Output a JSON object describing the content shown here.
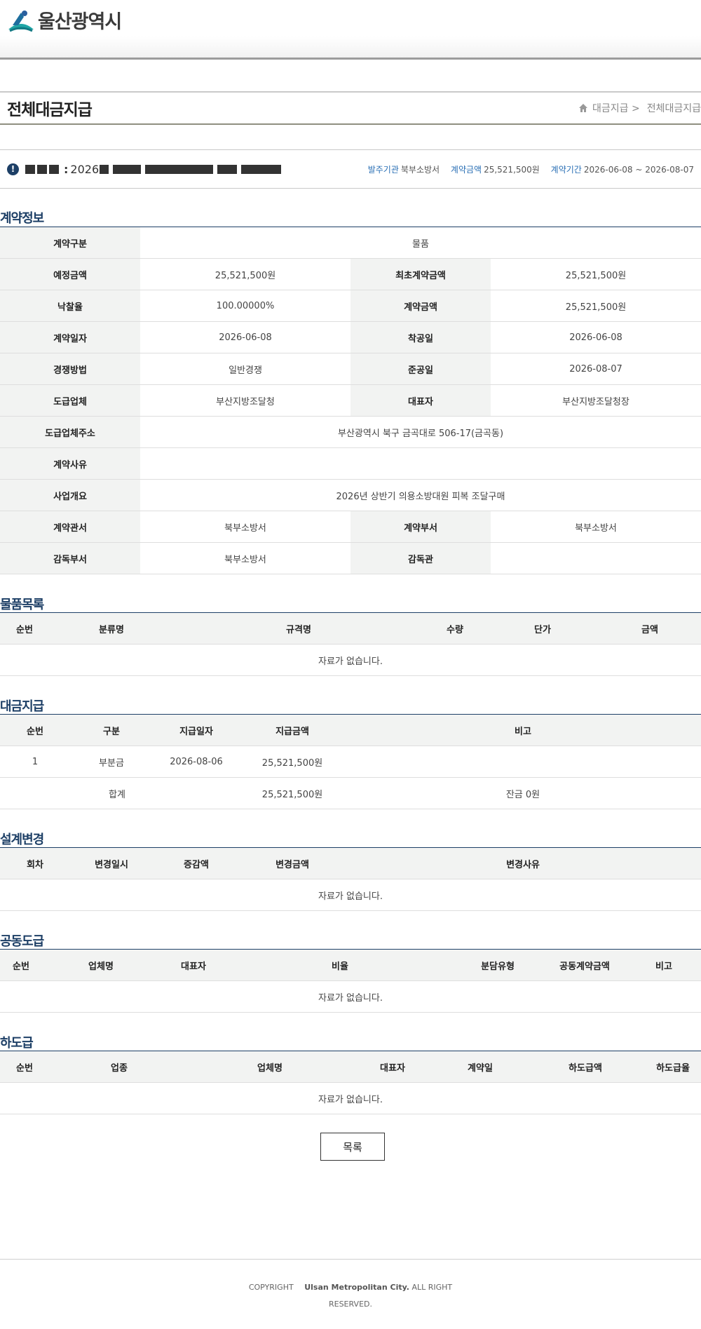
{
  "header": {
    "logo_text": "울산광역시"
  },
  "page": {
    "title": "전체대금지급",
    "breadcrumb": [
      "대금지급 >",
      "전체대금지급"
    ]
  },
  "summary": {
    "title_prefix": ":",
    "title_year": "2026",
    "agency_label": "발주기관",
    "agency_value": "북부소방서",
    "amount_label": "계약금액",
    "amount_value": "25,521,500원",
    "period_label": "계약기간",
    "period_value": "2026-06-08 ~ 2026-08-07"
  },
  "contract_info": {
    "section_title": "계약정보",
    "rows": [
      {
        "label1": "계약구분",
        "value1": "물품",
        "full": true
      },
      {
        "label1": "예정금액",
        "value1": "25,521,500원",
        "label2": "최초계약금액",
        "value2": "25,521,500원"
      },
      {
        "label1": "낙찰율",
        "value1": "100.00000%",
        "label2": "계약금액",
        "value2": "25,521,500원"
      },
      {
        "label1": "계약일자",
        "value1": "2026-06-08",
        "label2": "착공일",
        "value2": "2026-06-08"
      },
      {
        "label1": "경쟁방법",
        "value1": "일반경쟁",
        "label2": "준공일",
        "value2": "2026-08-07"
      },
      {
        "label1": "도급업체",
        "value1": "부산지방조달청",
        "label2": "대표자",
        "value2": "부산지방조달청장"
      },
      {
        "label1": "도급업체주소",
        "value1": "부산광역시 북구 금곡대로 506-17(금곡동)",
        "full": true
      },
      {
        "label1": "계약사유",
        "value1": "",
        "full": true
      },
      {
        "label1": "사업개요",
        "value1": "2026년 상반기 의용소방대원 피복 조달구매",
        "full": true
      },
      {
        "label1": "계약관서",
        "value1": "북부소방서",
        "label2": "계약부서",
        "value2": "북부소방서"
      },
      {
        "label1": "감독부서",
        "value1": "북부소방서",
        "label2": "감독관",
        "value2": ""
      }
    ]
  },
  "goods": {
    "section_title": "물품목록",
    "headers": [
      "순번",
      "분류명",
      "규격명",
      "수량",
      "단가",
      "금액"
    ],
    "empty": "자료가 없습니다."
  },
  "payments": {
    "section_title": "대금지급",
    "headers": [
      "순번",
      "구분",
      "지급일자",
      "지급금액",
      "비고"
    ],
    "rows": [
      {
        "no": "1",
        "type": "부분금",
        "date": "2026-08-06",
        "amount": "25,521,500원",
        "note": ""
      }
    ],
    "total_label": "합계",
    "total_amount": "25,521,500원",
    "balance": "잔금 0원"
  },
  "design_change": {
    "section_title": "설계변경",
    "headers": [
      "회차",
      "변경일시",
      "증감액",
      "변경금액",
      "변경사유"
    ],
    "empty": "자료가 없습니다."
  },
  "joint": {
    "section_title": "공동도급",
    "headers": [
      "순번",
      "업체명",
      "대표자",
      "비율",
      "분담유형",
      "공동계약금액",
      "비고"
    ],
    "empty": "자료가 없습니다."
  },
  "subcontract": {
    "section_title": "하도급",
    "headers": [
      "순번",
      "업종",
      "업체명",
      "대표자",
      "계약일",
      "하도급액",
      "하도급율"
    ],
    "empty": "자료가 없습니다."
  },
  "list_button": "목록",
  "footer": {
    "copyright": "COPYRIGHT",
    "brand": "Ulsan Metropolitan City.",
    "rights_1": "ALL RIGHT",
    "rights_2": "RESERVED."
  }
}
